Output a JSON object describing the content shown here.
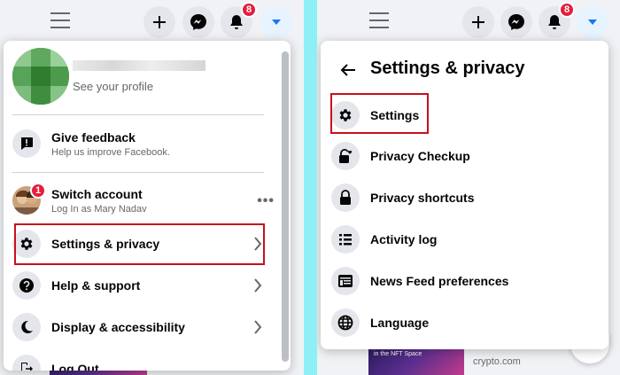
{
  "topbar": {
    "notification_badge": "8",
    "icons": [
      "menu-icon",
      "plus-icon",
      "messenger-icon",
      "bell-icon",
      "caret-down-icon"
    ]
  },
  "left_menu": {
    "see_profile": "See your profile",
    "items": [
      {
        "title": "Give feedback",
        "subtitle": "Help us improve Facebook.",
        "icon": "feedback-icon"
      },
      {
        "title": "Switch account",
        "subtitle": "Log In as Mary Nadav",
        "badge": "1",
        "icon": "avatar"
      },
      {
        "title": "Settings & privacy",
        "icon": "gear-icon"
      },
      {
        "title": "Help & support",
        "icon": "question-icon"
      },
      {
        "title": "Display & accessibility",
        "icon": "moon-icon"
      },
      {
        "title": "Log Out",
        "icon": "logout-icon"
      }
    ]
  },
  "right_menu": {
    "title": "Settings & privacy",
    "items": [
      {
        "label": "Settings",
        "icon": "gear-icon"
      },
      {
        "label": "Privacy Checkup",
        "icon": "lock-heart-icon"
      },
      {
        "label": "Privacy shortcuts",
        "icon": "lock-icon"
      },
      {
        "label": "Activity log",
        "icon": "list-icon"
      },
      {
        "label": "News Feed preferences",
        "icon": "feed-icon"
      },
      {
        "label": "Language",
        "icon": "globe-icon"
      }
    ]
  },
  "background_feed": {
    "thumb_caption": "in the NFT Space",
    "domain": "crypto.com"
  },
  "colors": {
    "highlight": "#c8101a",
    "badge": "#e41e3f",
    "accent": "#1877f2",
    "divider": "#8ef0f6"
  }
}
